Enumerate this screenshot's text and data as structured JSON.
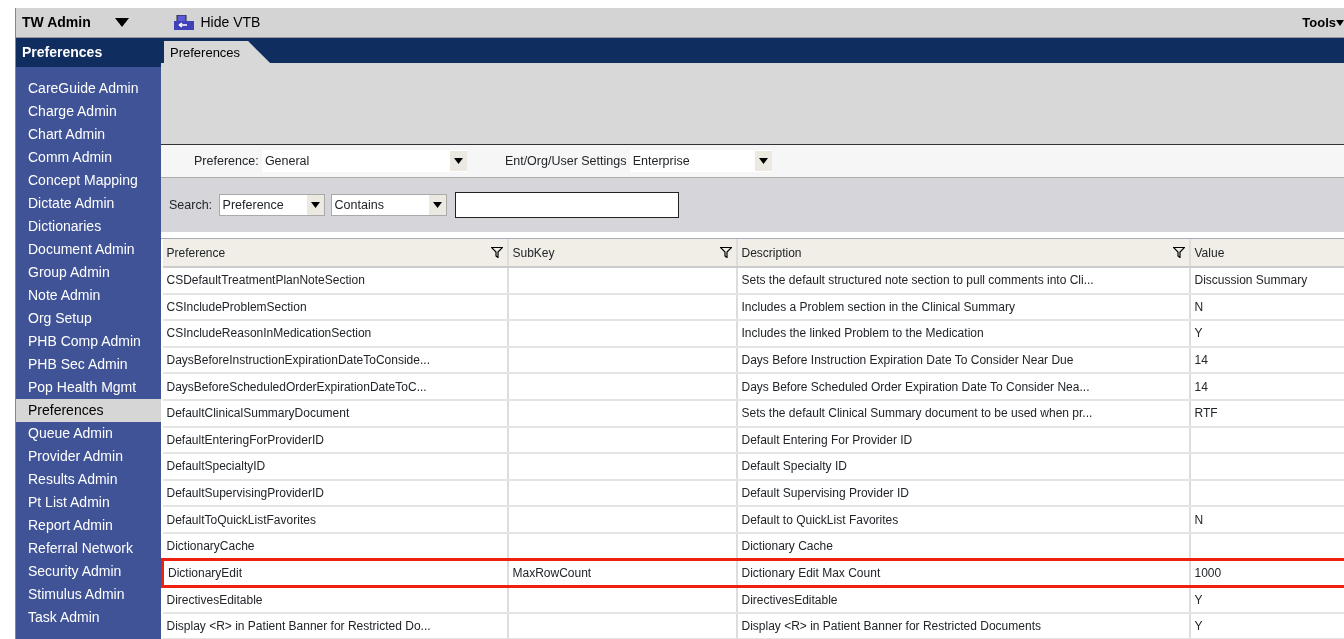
{
  "toolbar": {
    "app_menu": "TW Admin",
    "hide_button": "Hide VTB",
    "tools_menu": "Tools"
  },
  "sidebar": {
    "title": "Preferences",
    "items": [
      {
        "label": "CareGuide Admin",
        "selected": false
      },
      {
        "label": "Charge Admin",
        "selected": false
      },
      {
        "label": "Chart Admin",
        "selected": false
      },
      {
        "label": "Comm Admin",
        "selected": false
      },
      {
        "label": "Concept Mapping",
        "selected": false
      },
      {
        "label": "Dictate Admin",
        "selected": false
      },
      {
        "label": "Dictionaries",
        "selected": false
      },
      {
        "label": "Document Admin",
        "selected": false
      },
      {
        "label": "Group Admin",
        "selected": false
      },
      {
        "label": "Note Admin",
        "selected": false
      },
      {
        "label": "Org Setup",
        "selected": false
      },
      {
        "label": "PHB Comp Admin",
        "selected": false
      },
      {
        "label": "PHB Sec Admin",
        "selected": false
      },
      {
        "label": "Pop Health Mgmt",
        "selected": false
      },
      {
        "label": "Preferences",
        "selected": true
      },
      {
        "label": "Queue Admin",
        "selected": false
      },
      {
        "label": "Provider Admin",
        "selected": false
      },
      {
        "label": "Results Admin",
        "selected": false
      },
      {
        "label": "Pt List Admin",
        "selected": false
      },
      {
        "label": "Report Admin",
        "selected": false
      },
      {
        "label": "Referral Network",
        "selected": false
      },
      {
        "label": "Security Admin",
        "selected": false
      },
      {
        "label": "Stimulus Admin",
        "selected": false
      },
      {
        "label": "Task Admin",
        "selected": false
      }
    ]
  },
  "tabs": [
    {
      "label": "Preferences",
      "selected": true
    }
  ],
  "filters": {
    "preference_label": "Preference:",
    "preference_value": "General",
    "settings_label": "Ent/Org/User Settings",
    "settings_value": "Enterprise",
    "search_label": "Search:",
    "search_field": "Preference",
    "search_mode": "Contains"
  },
  "table": {
    "columns": [
      {
        "label": "Preference",
        "filter": true
      },
      {
        "label": "SubKey",
        "filter": true
      },
      {
        "label": "Description",
        "filter": true
      },
      {
        "label": "Value",
        "filter": false
      }
    ],
    "rows": [
      {
        "cells": [
          "CSDefaultTreatmentPlanNoteSection",
          "",
          "Sets the default structured note section to pull comments into Cli...",
          "Discussion Summary"
        ],
        "highlighted": false
      },
      {
        "cells": [
          "CSIncludeProblemSection",
          "",
          "Includes a Problem section in the Clinical Summary",
          "N"
        ],
        "highlighted": false
      },
      {
        "cells": [
          "CSIncludeReasonInMedicationSection",
          "",
          "Includes the linked Problem to the Medication",
          "Y"
        ],
        "highlighted": false
      },
      {
        "cells": [
          "DaysBeforeInstructionExpirationDateToConside...",
          "",
          "Days Before Instruction Expiration Date To Consider Near Due",
          "14"
        ],
        "highlighted": false
      },
      {
        "cells": [
          "DaysBeforeScheduledOrderExpirationDateToC...",
          "",
          "Days Before Scheduled Order Expiration Date To Consider Nea...",
          "14"
        ],
        "highlighted": false
      },
      {
        "cells": [
          "DefaultClinicalSummaryDocument",
          "",
          "Sets the default Clinical Summary document to be used when pr...",
          "RTF"
        ],
        "highlighted": false
      },
      {
        "cells": [
          "DefaultEnteringForProviderID",
          "",
          "Default Entering For Provider ID",
          ""
        ],
        "highlighted": false
      },
      {
        "cells": [
          "DefaultSpecialtyID",
          "",
          "Default Specialty ID",
          ""
        ],
        "highlighted": false
      },
      {
        "cells": [
          "DefaultSupervisingProviderID",
          "",
          "Default Supervising Provider ID",
          ""
        ],
        "highlighted": false
      },
      {
        "cells": [
          "DefaultToQuickListFavorites",
          "",
          "Default to QuickList Favorites",
          "N"
        ],
        "highlighted": false
      },
      {
        "cells": [
          "DictionaryCache",
          "",
          "Dictionary Cache",
          ""
        ],
        "highlighted": false
      },
      {
        "cells": [
          "DictionaryEdit",
          "MaxRowCount",
          "Dictionary Edit Max Count",
          "1000"
        ],
        "highlighted": true
      },
      {
        "cells": [
          "DirectivesEditable",
          "",
          "DirectivesEditable",
          "Y"
        ],
        "highlighted": false
      },
      {
        "cells": [
          "Display <R> in Patient Banner for Restricted Do...",
          "",
          "Display <R> in Patient Banner for Restricted Documents",
          "Y"
        ],
        "highlighted": false
      }
    ]
  }
}
